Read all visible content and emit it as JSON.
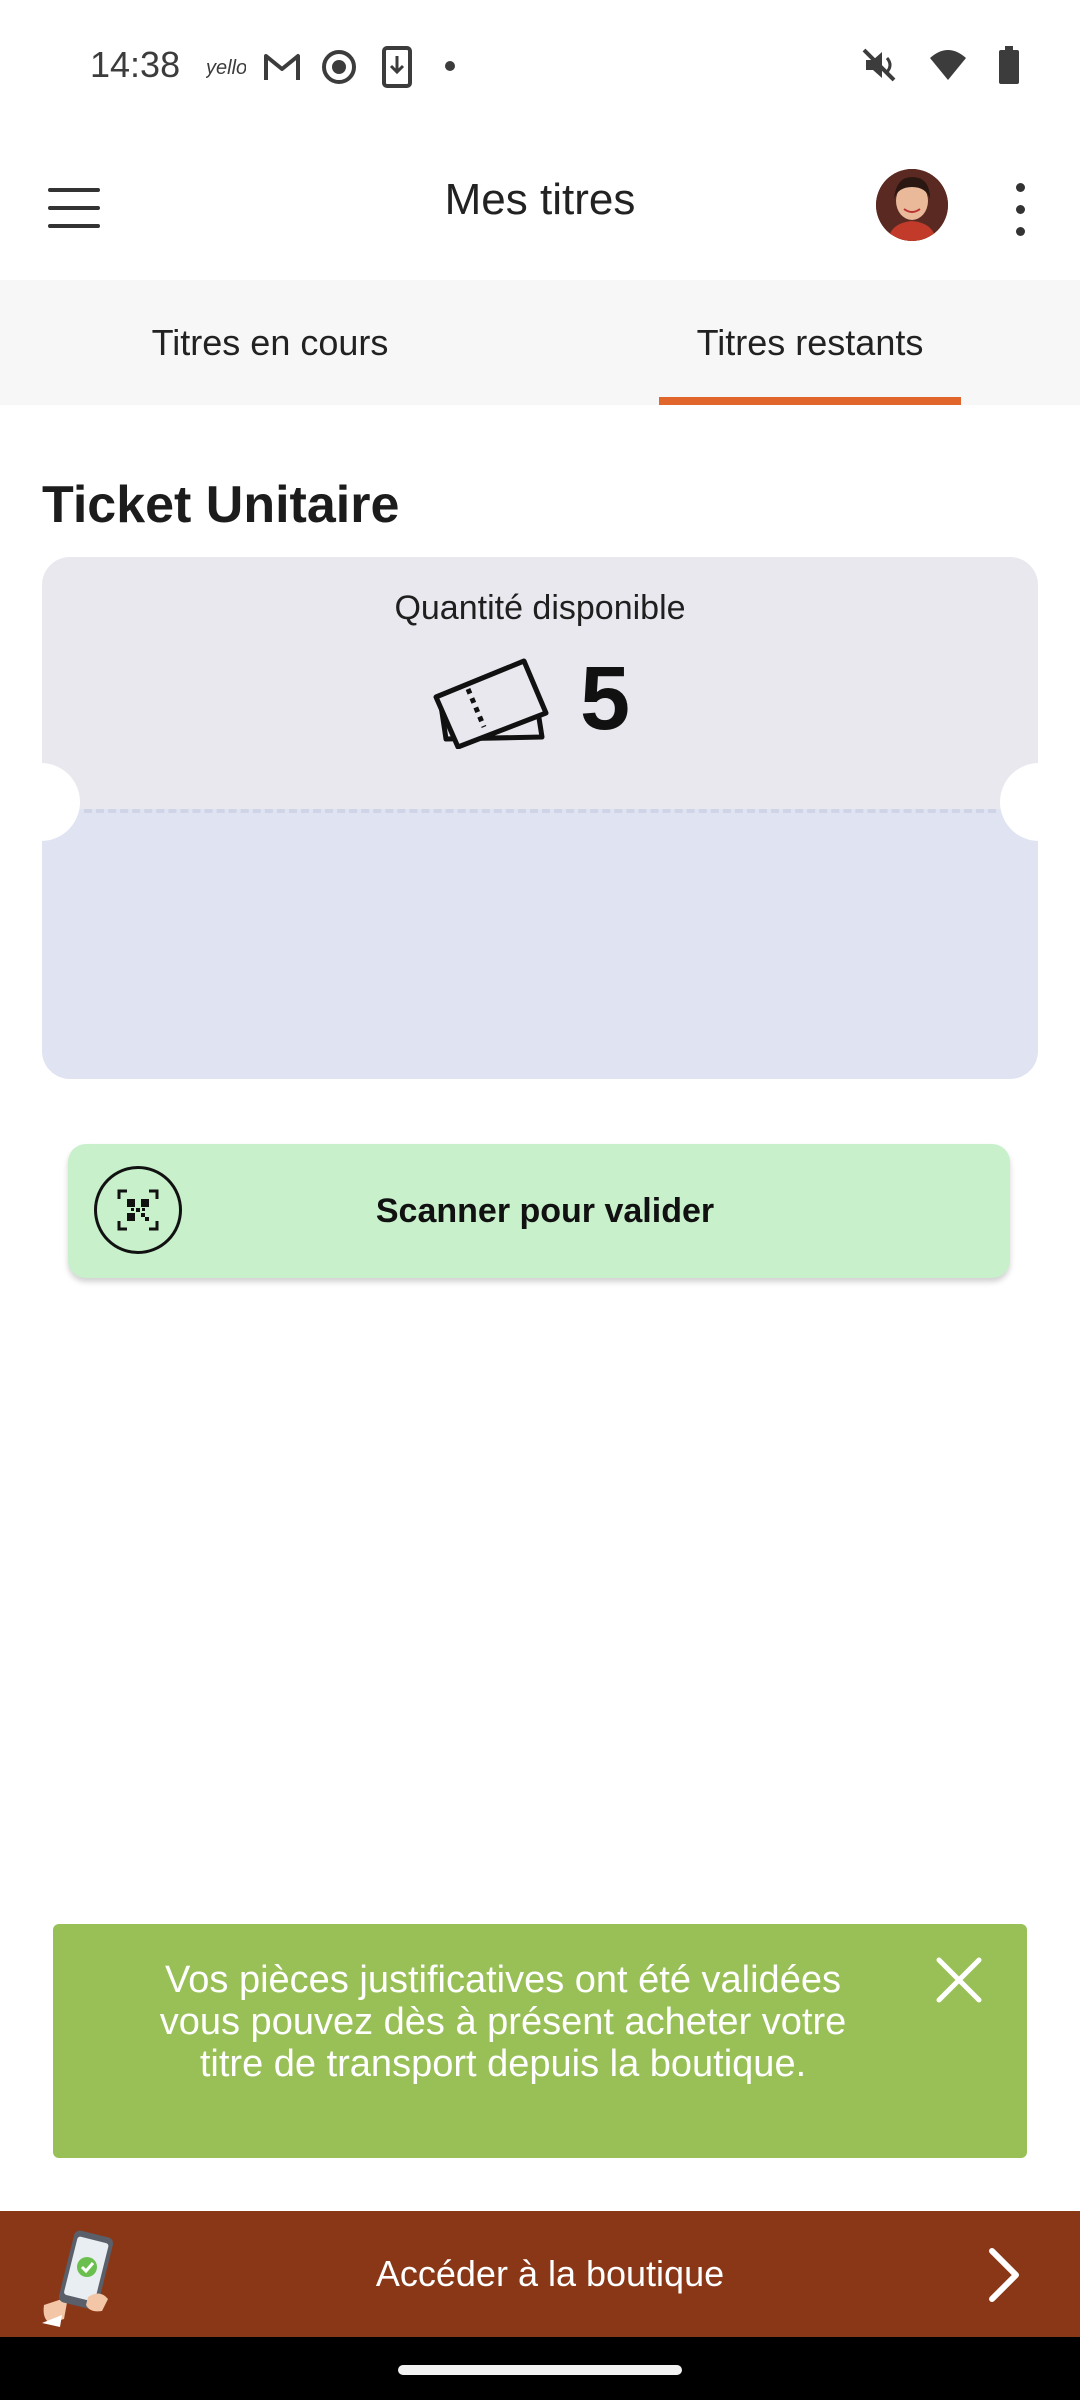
{
  "status_bar": {
    "time": "14:38",
    "icons_left": [
      "yello-icon",
      "gmail-icon",
      "record-icon",
      "download-icon",
      "dot-icon"
    ],
    "icons_right": [
      "mute-icon",
      "wifi-icon",
      "battery-icon"
    ]
  },
  "app_bar": {
    "title": "Mes titres",
    "menu_icon": "hamburger-icon",
    "more_icon": "more-vert-icon"
  },
  "tabs": [
    {
      "label": "Titres en cours",
      "selected": false
    },
    {
      "label": "Titres restants",
      "selected": true
    }
  ],
  "accent_color": "#e0662c",
  "section": {
    "title": "Ticket Unitaire",
    "quantity_label": "Quantité disponible",
    "quantity_value": "5",
    "scan_button_label": "Scanner pour valider"
  },
  "snackbar": {
    "message": "Vos pièces justificatives ont été validées vous pouvez dès à présent acheter votre titre de transport depuis la boutique.",
    "color": "#98c056"
  },
  "shop_bar": {
    "label": "Accéder à la boutique",
    "color": "#8a3718"
  }
}
